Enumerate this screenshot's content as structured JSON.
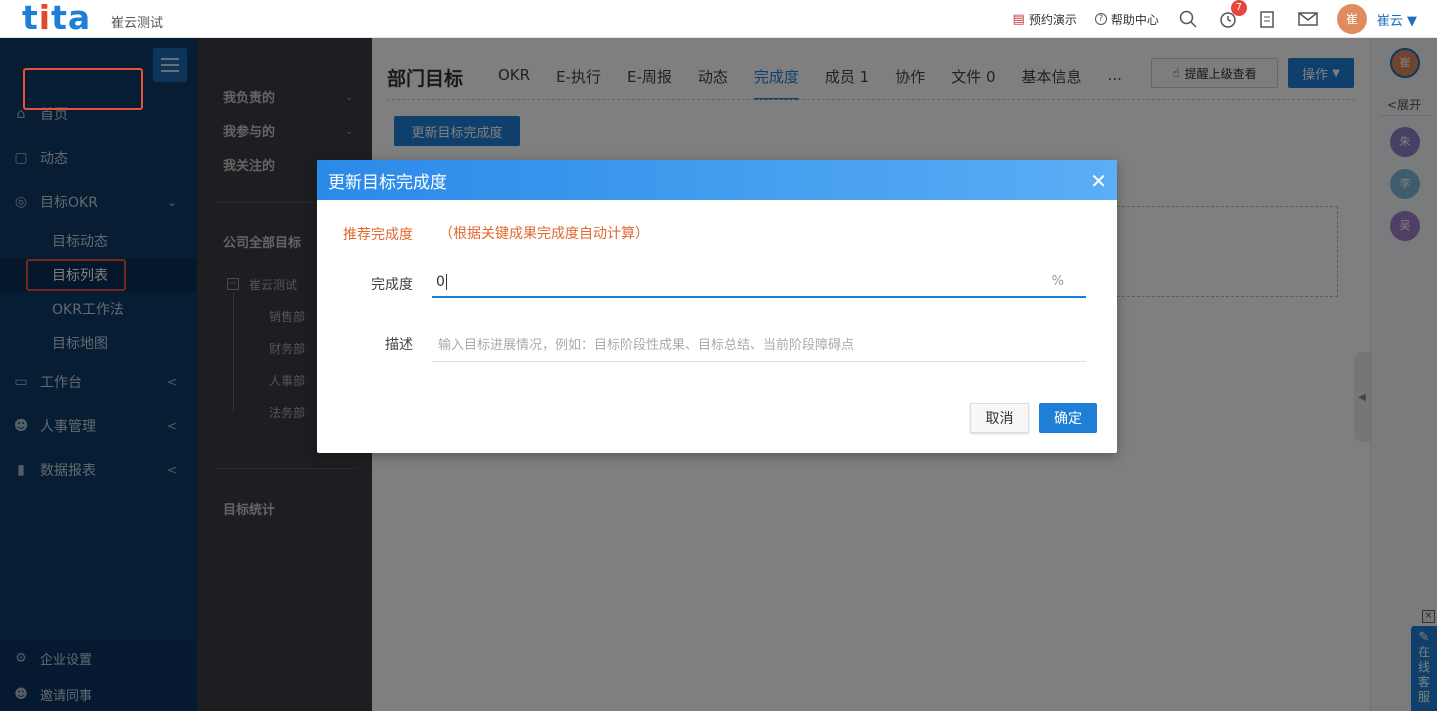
{
  "header": {
    "logo": "tita",
    "company": "崔云测试",
    "links": [
      {
        "icon": "book-icon",
        "label": "预约演示"
      },
      {
        "icon": "help-icon",
        "label": "帮助中心"
      }
    ],
    "notification_count": "7",
    "avatar_text": "崔",
    "user_name": "崔云"
  },
  "sidebar": {
    "items": [
      {
        "icon": "home-icon",
        "label": "首页"
      },
      {
        "icon": "chat-icon",
        "label": "动态"
      },
      {
        "icon": "target-icon",
        "label": "目标OKR"
      },
      {
        "icon": "monitor-icon",
        "label": "工作台"
      },
      {
        "icon": "person-icon",
        "label": "人事管理"
      },
      {
        "icon": "chart-icon",
        "label": "数据报表"
      }
    ],
    "sub_items": [
      "目标动态",
      "目标列表",
      "OKR工作法",
      "目标地图"
    ],
    "bottom": [
      {
        "icon": "gear-icon",
        "label": "企业设置"
      },
      {
        "icon": "invite-icon",
        "label": "邀请同事"
      }
    ]
  },
  "sidebar2": {
    "items": [
      "我负责的",
      "我参与的",
      "我关注的"
    ],
    "section": "公司全部目标",
    "tree_root": "崔云测试",
    "tree_children": [
      "销售部",
      "财务部",
      "人事部",
      "法务部"
    ],
    "stats": "目标统计"
  },
  "main": {
    "title": "部门目标",
    "tabs": [
      "OKR",
      "E-执行",
      "E-周报",
      "动态",
      "完成度",
      "成员 1",
      "协作",
      "文件 0",
      "基本信息",
      "..."
    ],
    "remind_label": "提醒上级查看",
    "op_label": "操作",
    "update_label": "更新目标完成度"
  },
  "rightbar": {
    "expand_label": "展开",
    "avatars": [
      "崔",
      "朱",
      "李",
      "吴"
    ],
    "online_cs": "在线客服"
  },
  "dialog": {
    "title": "更新目标完成度",
    "rec_label": "推荐完成度",
    "rec_note": "（根据关键成果完成度自动计算）",
    "value_label": "完成度",
    "value": "0",
    "unit": "%",
    "desc_label": "描述",
    "desc_placeholder": "输入目标进展情况，例如：目标阶段性成果、目标总结、当前阶段障碍点",
    "cancel": "取消",
    "ok": "确定"
  },
  "colors": {
    "primary": "#1e7fd6",
    "sidebar_bg": "#0d3a66",
    "highlight": "#e8513a",
    "orange_text": "#e0692e"
  }
}
